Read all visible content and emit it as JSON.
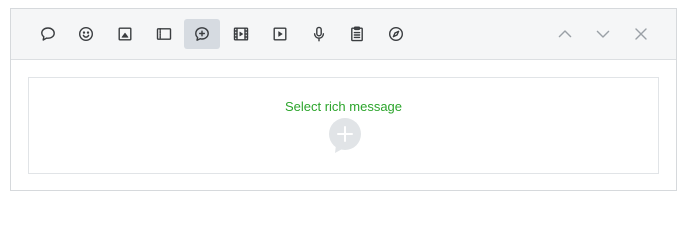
{
  "toolbar": {
    "tools": [
      {
        "icon": "speech-bubble-icon",
        "active": false
      },
      {
        "icon": "smiley-icon",
        "active": false
      },
      {
        "icon": "image-icon",
        "active": false
      },
      {
        "icon": "card-icon",
        "active": false
      },
      {
        "icon": "rich-message-icon",
        "active": true
      },
      {
        "icon": "video-icon",
        "active": false
      },
      {
        "icon": "play-icon",
        "active": false
      },
      {
        "icon": "microphone-icon",
        "active": false
      },
      {
        "icon": "clipboard-icon",
        "active": false
      },
      {
        "icon": "compass-icon",
        "active": false
      }
    ],
    "nav": [
      {
        "icon": "chevron-up-icon"
      },
      {
        "icon": "chevron-down-icon"
      },
      {
        "icon": "close-icon"
      }
    ]
  },
  "content": {
    "label": "Select rich message",
    "add_icon": "add-bubble-icon"
  },
  "colors": {
    "accent": "#2ca52c",
    "toolbar_bg": "#f5f6f7",
    "active_bg": "#d6dbe1"
  }
}
